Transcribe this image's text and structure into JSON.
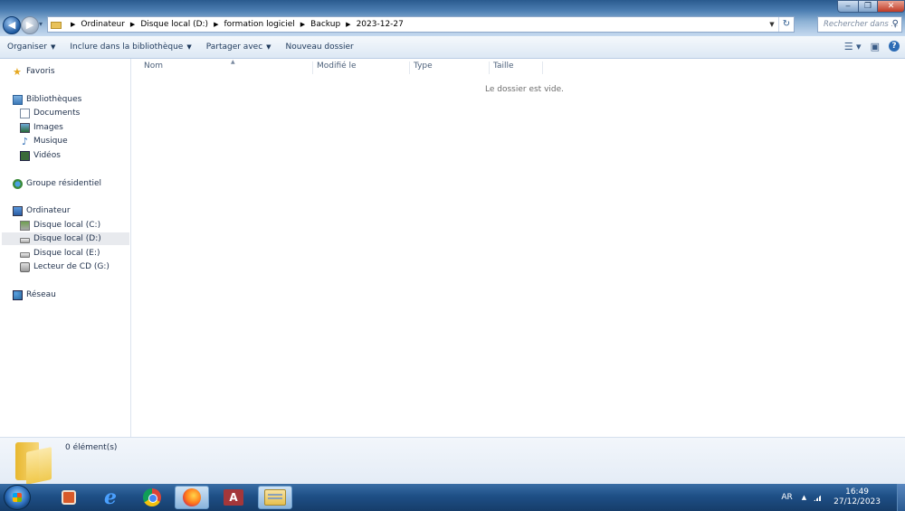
{
  "addressbar": {
    "crumbs": [
      "Ordinateur",
      "Disque local (D:)",
      "formation logiciel",
      "Backup",
      "2023-12-27"
    ],
    "search_placeholder": "Rechercher dans ..."
  },
  "toolbar": {
    "organize": "Organiser",
    "include": "Inclure dans la bibliothèque",
    "share": "Partager avec",
    "new_folder": "Nouveau dossier"
  },
  "nav": {
    "favorites": "Favoris",
    "libraries": "Bibliothèques",
    "documents": "Documents",
    "images": "Images",
    "music": "Musique",
    "videos": "Vidéos",
    "homegroup": "Groupe résidentiel",
    "computer": "Ordinateur",
    "drive_c": "Disque local (C:)",
    "drive_d": "Disque local (D:)",
    "drive_e": "Disque local (E:)",
    "cd_drive": "Lecteur de CD (G:)",
    "network": "Réseau"
  },
  "columns": {
    "name": "Nom",
    "modified": "Modifié le",
    "type": "Type",
    "size": "Taille"
  },
  "content": {
    "empty_message": "Le dossier est vide."
  },
  "details": {
    "item_count": "0 élément(s)"
  },
  "taskbar": {
    "lang": "AR",
    "time": "16:49",
    "date": "27/12/2023"
  }
}
